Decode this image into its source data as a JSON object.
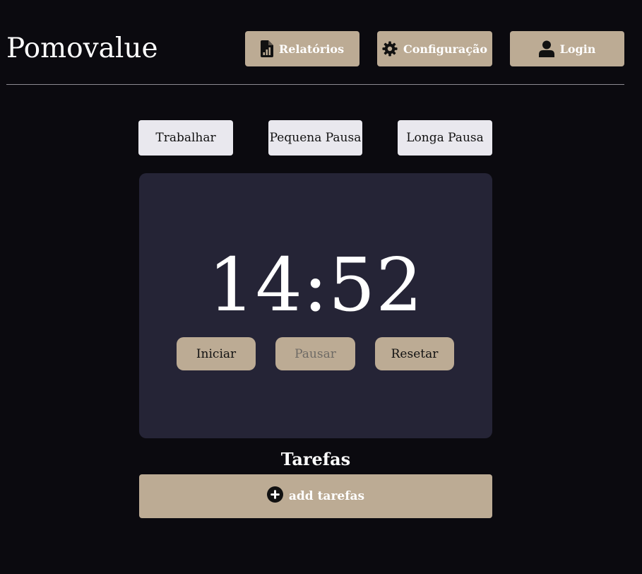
{
  "header": {
    "app_title": "Pomovalue",
    "nav": {
      "reports_label": "Relatórios",
      "reports_icon": "file-chart-icon",
      "settings_label": "Configuração",
      "settings_icon": "gear-icon",
      "login_label": "Login",
      "login_icon": "user-icon"
    }
  },
  "modes": {
    "work_label": "Trabalhar",
    "short_break_label": "Pequena Pausa",
    "long_break_label": "Longa Pausa"
  },
  "timer": {
    "display": "14:52",
    "start_label": "Iniciar",
    "pause_label": "Pausar",
    "pause_disabled": true,
    "reset_label": "Resetar"
  },
  "tasks": {
    "title": "Tarefas",
    "add_label": "add tarefas",
    "add_icon": "plus-circle-icon"
  },
  "colors": {
    "background": "#0b0a0f",
    "accent": "#bcab94",
    "card": "#252436",
    "mode_button": "#e9e8ee",
    "text": "#ffffff"
  }
}
